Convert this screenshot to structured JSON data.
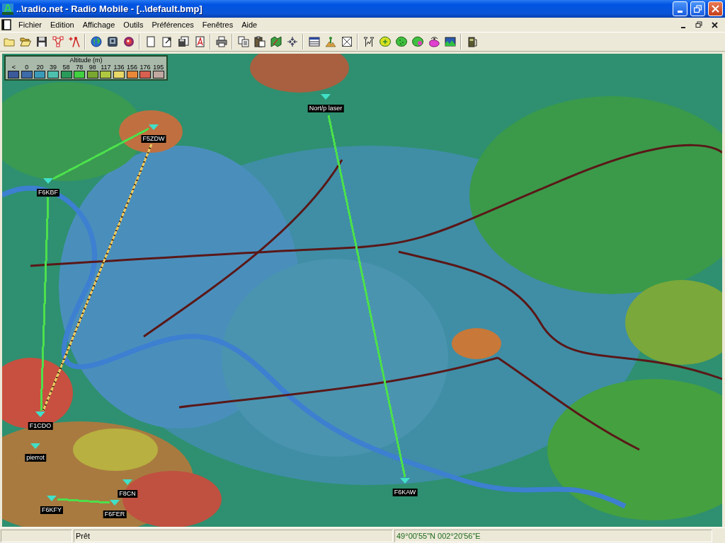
{
  "window": {
    "title": "..\\radio.net - Radio Mobile - [..\\default.bmp]"
  },
  "menu": [
    "Fichier",
    "Edition",
    "Affichage",
    "Outils",
    "Préférences",
    "Fenêtres",
    "Aide"
  ],
  "map": {
    "legend": {
      "title": "Altitude (m)",
      "items": [
        {
          "label": "<",
          "color": "#3a5a9a"
        },
        {
          "label": "0",
          "color": "#3d6aa8"
        },
        {
          "label": "20",
          "color": "#3a9ab8"
        },
        {
          "label": "39",
          "color": "#4ec0b0"
        },
        {
          "label": "58",
          "color": "#2a9a5a"
        },
        {
          "label": "78",
          "color": "#40d040"
        },
        {
          "label": "98",
          "color": "#78a830"
        },
        {
          "label": "117",
          "color": "#b0c840"
        },
        {
          "label": "136",
          "color": "#e8d868"
        },
        {
          "label": "156",
          "color": "#e88838"
        },
        {
          "label": "176",
          "color": "#d86050"
        },
        {
          "label": "195",
          "color": "#c0a8a0"
        }
      ]
    },
    "stations": [
      {
        "label": "Nort/p laser"
      },
      {
        "label": "F5ZDW"
      },
      {
        "label": "F6KBF"
      },
      {
        "label": "F1CDO"
      },
      {
        "label": "pierrot"
      },
      {
        "label": "F6KAW"
      },
      {
        "label": "F8CN"
      },
      {
        "label": "F6KFY"
      },
      {
        "label": "F6FER"
      }
    ],
    "links": [
      {
        "kind": "solid",
        "color": "#4ce04c"
      },
      {
        "kind": "solid",
        "color": "#4ce04c"
      },
      {
        "kind": "dashed",
        "color": "#e8c860"
      },
      {
        "kind": "solid",
        "color": "#4ce04c"
      },
      {
        "kind": "solid",
        "color": "#4ce04c"
      }
    ]
  },
  "status_bar": {
    "message": "Prêt",
    "coordinates": "49°00'55\"N 002°20'56\"E"
  }
}
